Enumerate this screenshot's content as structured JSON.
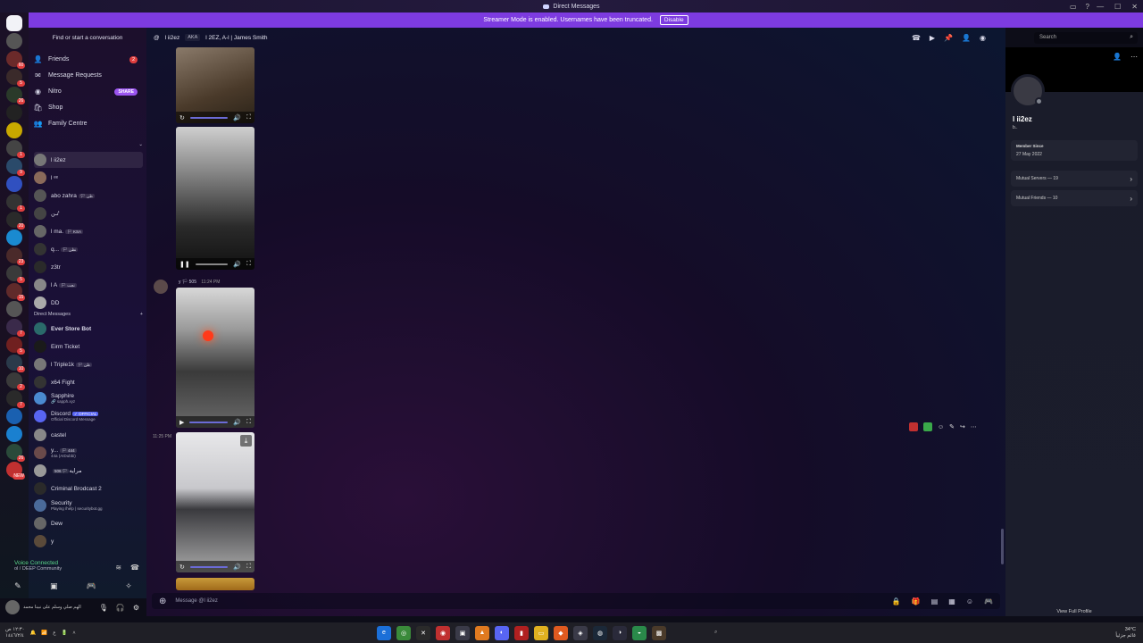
{
  "window": {
    "title": "Direct Messages"
  },
  "banner": {
    "text": "Streamer Mode is enabled. Usernames have been truncated.",
    "disable_label": "Disable"
  },
  "sidebar": {
    "search_placeholder": "Find or start a conversation",
    "nav": [
      {
        "label": "Friends",
        "icon": "friends-icon",
        "badge": "2"
      },
      {
        "label": "Message Requests",
        "icon": "envelope-icon"
      },
      {
        "label": "Nitro",
        "icon": "nitro-icon",
        "pill": "SHARE"
      },
      {
        "label": "Shop",
        "icon": "shop-icon"
      },
      {
        "label": "Family Centre",
        "icon": "family-icon"
      }
    ],
    "pinned": [
      {
        "name": "l ii2ez",
        "active": true
      },
      {
        "name": "l ᵉᵉ"
      },
      {
        "name": "abo zahra",
        "tag": "🏳 ظن"
      },
      {
        "name": "ٸن"
      },
      {
        "name": "l ma.",
        "tag": "🏳 KSA"
      },
      {
        "name": "q...",
        "tag": "🏳 نظن"
      },
      {
        "name": "z3tr"
      },
      {
        "name": "l A",
        "tag": "🏳 نجت"
      },
      {
        "name": "DD"
      }
    ],
    "dm_header": "Direct Messages",
    "dms": [
      {
        "name": "Ever Store Bot",
        "bold": true
      },
      {
        "name": "Eirm Ticket"
      },
      {
        "name": "l Triple1k",
        "tag": "🏳 ظن"
      },
      {
        "name": "x64 Fight"
      },
      {
        "name": "Sapphire",
        "sub": "🔗 sapph.xyz"
      },
      {
        "name": "Discord",
        "official": "✓ OFFICIAL",
        "sub": "Official Discord Message"
      },
      {
        "name": "castel"
      },
      {
        "name": "y...",
        "tag": "🏳 444",
        "sub": "44a (AIDubbi)"
      },
      {
        "name": "مرايه",
        "tag": "🏳 506"
      },
      {
        "name": "Criminal Brodcast 2"
      },
      {
        "name": "Security",
        "sub": "Playing /help | securitybot.gg"
      },
      {
        "name": "Dew"
      },
      {
        "name": "y"
      }
    ]
  },
  "voice": {
    "status": "Voice Connected",
    "channel": "ol / DEEP Community"
  },
  "user_panel": {
    "name": "الهم صلي وسلم على نبينا محمد"
  },
  "chat": {
    "recipient": "l ii2ez",
    "aka_label": "AKA",
    "aka_names": "l 2EZ, A-l | James Smith",
    "search_placeholder": "Search",
    "msg1_author": "y",
    "msg1_tag": "🏳 505",
    "msg1_time": "11:24 PM",
    "msg2_time": "11:25 PM",
    "composer_placeholder": "Message @l ii2ez"
  },
  "profile": {
    "name": "l ii2ez",
    "tag": "b..",
    "member_since_label": "Member Since",
    "member_since": "27 May 2022",
    "mutual_servers": "Mutual Servers — 19",
    "mutual_friends": "Mutual Friends — 10",
    "full_profile": "View Full Profile"
  },
  "taskbar": {
    "weather_temp": "34°C",
    "weather_desc": "غائم جزئياً",
    "time": "١٢:٣٠ ص",
    "date": "١٤٤٦/٢/٤",
    "lang": "ع"
  },
  "colors": {
    "accent": "#7d3be0",
    "badge": "#e03e3e",
    "voice_green": "#5ad68a"
  }
}
